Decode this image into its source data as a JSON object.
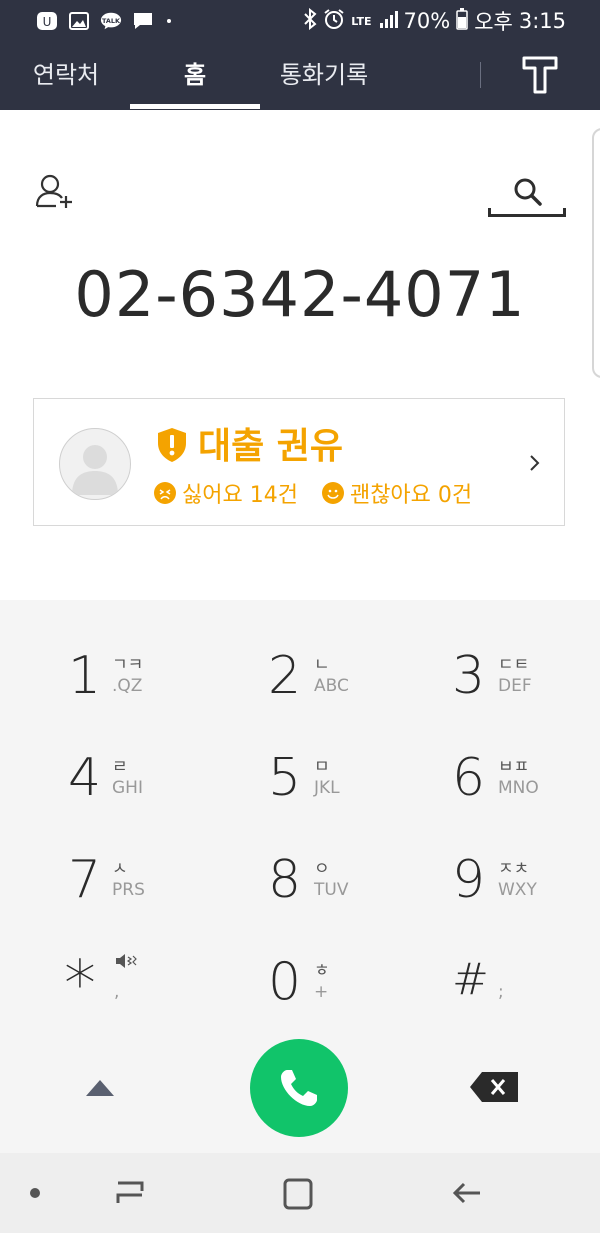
{
  "status_bar": {
    "battery": "70%",
    "network": "LTE",
    "ampm": "오후",
    "time": "3:15",
    "icons": [
      "uplus-icon",
      "gallery-icon",
      "talk-icon",
      "message-icon",
      "dot-icon",
      "bluetooth-icon",
      "alarm-icon",
      "signal-icon",
      "battery-icon"
    ]
  },
  "tabs": [
    {
      "label": "연락처"
    },
    {
      "label": "홈"
    },
    {
      "label": "통화기록"
    }
  ],
  "main": {
    "number": "02-6342-4071"
  },
  "spam_card": {
    "title": "대출 권유",
    "dislike": "싫어요 14건",
    "like": "괜찮아요 0건"
  },
  "keypad": {
    "keys": [
      {
        "digit": "1",
        "kor": "ㄱㅋ",
        "lat": ".QZ"
      },
      {
        "digit": "2",
        "kor": "ㄴ",
        "lat": "ABC"
      },
      {
        "digit": "3",
        "kor": "ㄷㅌ",
        "lat": "DEF"
      },
      {
        "digit": "4",
        "kor": "ㄹ",
        "lat": "GHI"
      },
      {
        "digit": "5",
        "kor": "ㅁ",
        "lat": "JKL"
      },
      {
        "digit": "6",
        "kor": "ㅂㅍ",
        "lat": "MNO"
      },
      {
        "digit": "7",
        "kor": "ㅅ",
        "lat": "PRS"
      },
      {
        "digit": "8",
        "kor": "ㅇ",
        "lat": "TUV"
      },
      {
        "digit": "9",
        "kor": "ㅈㅊ",
        "lat": "WXY"
      },
      {
        "digit": "*",
        "kor": "",
        "lat": ","
      },
      {
        "digit": "0",
        "kor": "ㅎ",
        "lat": "+"
      },
      {
        "digit": "#",
        "kor": "",
        "lat": ";"
      }
    ]
  },
  "colors": {
    "header": "#2f3342",
    "accent_orange": "#f4a300",
    "call_green": "#11c46a",
    "keypad_bg": "#f5f5f5"
  }
}
